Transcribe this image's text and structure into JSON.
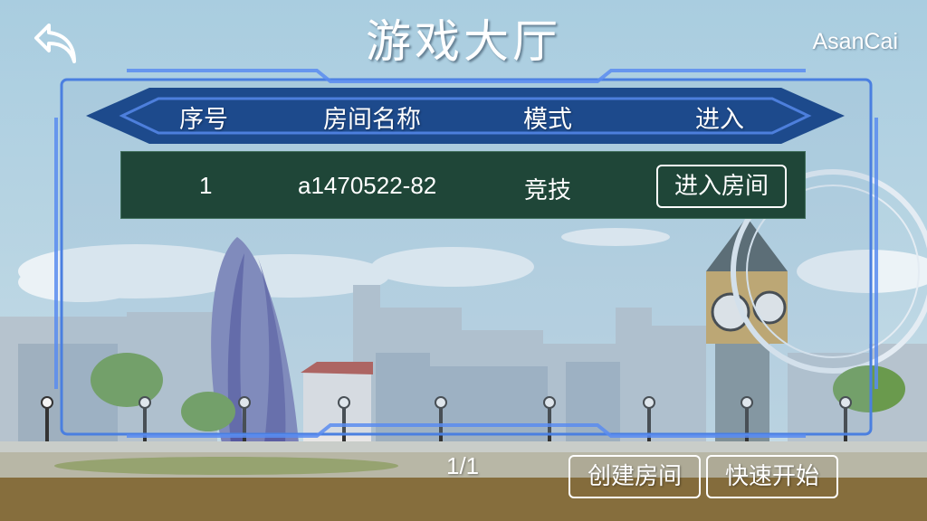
{
  "header": {
    "title": "游戏大厅",
    "username": "AsanCai"
  },
  "table": {
    "columns": [
      "序号",
      "房间名称",
      "模式",
      "进入"
    ],
    "rows": [
      {
        "index": "1",
        "room_name": "a1470522-82",
        "mode": "竞技",
        "join_label": "进入房间"
      }
    ]
  },
  "footer": {
    "page": "1/1",
    "create_room_label": "创建房间",
    "quick_start_label": "快速开始"
  },
  "colors": {
    "header_bar": "#1d4a8c",
    "row_background": "#1f4638",
    "frame_line": "#4a7fe0",
    "text": "#ffffff"
  },
  "icons": {
    "back": "back-arrow-icon"
  }
}
